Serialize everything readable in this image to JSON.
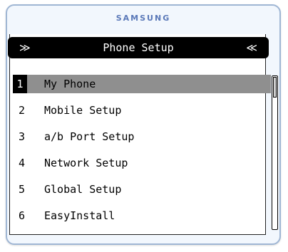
{
  "brand": "SAMSUNG",
  "titlebar": {
    "title": "Phone Setup",
    "left_arrow": "≫",
    "right_arrow": "≪",
    "left_arrow_icon": "double-chevron-right-icon",
    "right_arrow_icon": "double-chevron-left-icon"
  },
  "menu": {
    "selected_index": 0,
    "items": [
      {
        "num": "1",
        "label": "My Phone"
      },
      {
        "num": "2",
        "label": "Mobile Setup"
      },
      {
        "num": "3",
        "label": "a/b Port Setup"
      },
      {
        "num": "4",
        "label": "Network Setup"
      },
      {
        "num": "5",
        "label": "Global Setup"
      },
      {
        "num": "6",
        "label": "EasyInstall"
      }
    ]
  },
  "scrollbar": {
    "position_fraction": 0.0
  },
  "colors": {
    "device_bg": "#f2f7fd",
    "device_border": "#9fb6d4",
    "brand": "#5a78b8",
    "titlebar_bg": "#000000",
    "selected_bg": "#8f8f8f"
  }
}
